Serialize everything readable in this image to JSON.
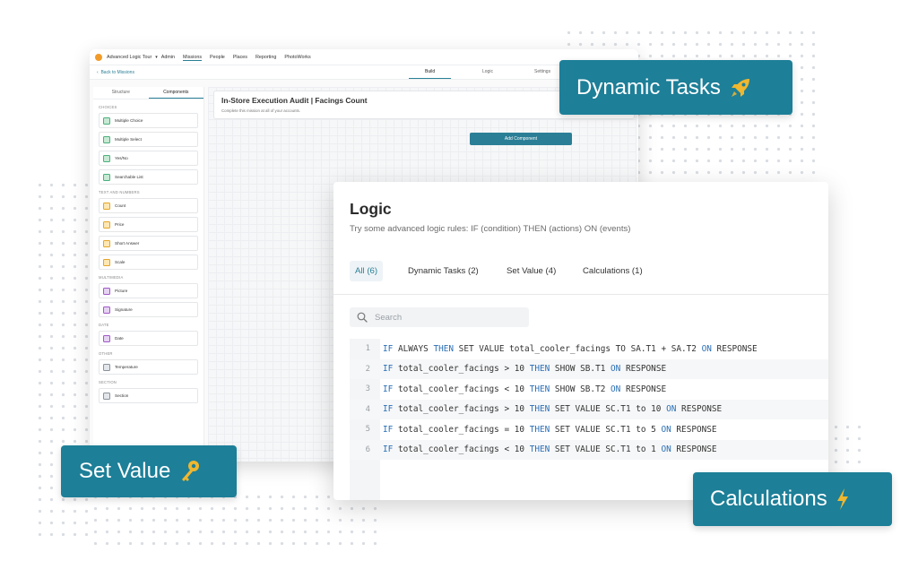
{
  "app": {
    "title": "Advanced Logic Tour",
    "nav": [
      "Admin",
      "Missions",
      "People",
      "Places",
      "Reporting",
      "PhotoWorks"
    ],
    "active_nav": "Missions",
    "back_link": "Back to Missions",
    "subtabs": [
      "Build",
      "Logic",
      "Settings"
    ],
    "active_subtab": "Build",
    "side_tabs": [
      "Structure",
      "Components"
    ],
    "active_side_tab": "Components",
    "sections": [
      {
        "title": "CHOICES",
        "items": [
          {
            "label": "Multiple Choice",
            "icon": "check-icon",
            "color": "green"
          },
          {
            "label": "Multiple Select",
            "icon": "check-icon",
            "color": "green"
          },
          {
            "label": "Yes/No",
            "icon": "check-icon",
            "color": "green"
          },
          {
            "label": "Searchable List",
            "icon": "list-icon",
            "color": "green"
          }
        ]
      },
      {
        "title": "TEXT AND NUMBERS",
        "items": [
          {
            "label": "Count",
            "icon": "hash-icon",
            "color": "yellow"
          },
          {
            "label": "Price",
            "icon": "dollar-icon",
            "color": "yellow"
          },
          {
            "label": "Short Answer",
            "icon": "text-icon",
            "color": "yellow"
          },
          {
            "label": "Scale",
            "icon": "scale-icon",
            "color": "yellow"
          }
        ]
      },
      {
        "title": "MULTIMEDIA",
        "items": [
          {
            "label": "Picture",
            "icon": "camera-icon",
            "color": "purple"
          },
          {
            "label": "Signature",
            "icon": "pen-icon",
            "color": "purple"
          }
        ]
      },
      {
        "title": "DATE",
        "items": [
          {
            "label": "Date",
            "icon": "calendar-icon",
            "color": "purple"
          }
        ]
      },
      {
        "title": "OTHER",
        "items": [
          {
            "label": "Temperature",
            "icon": "thermometer-icon",
            "color": "gray"
          }
        ]
      },
      {
        "title": "SECTION",
        "items": [
          {
            "label": "Section",
            "icon": "section-icon",
            "color": "gray"
          }
        ]
      }
    ],
    "mission_title": "In-Store Execution Audit | Facings Count",
    "mission_subtitle": "Complete this mission at all of your accounts.",
    "add_component": "Add Component"
  },
  "logic": {
    "title": "Logic",
    "subtitle": "Try some advanced logic rules: IF (condition) THEN (actions) ON (events)",
    "tabs": [
      "All (6)",
      "Dynamic Tasks (2)",
      "Set Value (4)",
      "Calculations (1)"
    ],
    "active_tab": "All (6)",
    "search_placeholder": "Search",
    "lines": [
      {
        "n": "1",
        "parts": [
          [
            "kw",
            "IF"
          ],
          [
            "t",
            " ALWAYS "
          ],
          [
            "kw",
            "THEN"
          ],
          [
            "t",
            " SET VALUE total_cooler_facings TO SA.T1 + SA.T2 "
          ],
          [
            "kw",
            "ON"
          ],
          [
            "t",
            " RESPONSE"
          ]
        ]
      },
      {
        "n": "2",
        "parts": [
          [
            "kw",
            "IF"
          ],
          [
            "t",
            " total_cooler_facings > 10 "
          ],
          [
            "kw",
            "THEN"
          ],
          [
            "t",
            " SHOW SB.T1 "
          ],
          [
            "kw",
            "ON"
          ],
          [
            "t",
            " RESPONSE"
          ]
        ]
      },
      {
        "n": "3",
        "parts": [
          [
            "kw",
            "IF"
          ],
          [
            "t",
            " total_cooler_facings < 10 "
          ],
          [
            "kw",
            "THEN"
          ],
          [
            "t",
            " SHOW SB.T2 "
          ],
          [
            "kw",
            "ON"
          ],
          [
            "t",
            " RESPONSE"
          ]
        ]
      },
      {
        "n": "4",
        "parts": [
          [
            "kw",
            "IF"
          ],
          [
            "t",
            " total_cooler_facings > 10 "
          ],
          [
            "kw",
            "THEN"
          ],
          [
            "t",
            " SET VALUE SC.T1 to 10 "
          ],
          [
            "kw",
            "ON"
          ],
          [
            "t",
            " RESPONSE"
          ]
        ]
      },
      {
        "n": "5",
        "parts": [
          [
            "kw",
            "IF"
          ],
          [
            "t",
            " total_cooler_facings = 10 "
          ],
          [
            "kw",
            "THEN"
          ],
          [
            "t",
            " SET VALUE SC.T1 to 5 "
          ],
          [
            "kw",
            "ON"
          ],
          [
            "t",
            " RESPONSE"
          ]
        ]
      },
      {
        "n": "6",
        "parts": [
          [
            "kw",
            "IF"
          ],
          [
            "t",
            " total_cooler_facings < 10 "
          ],
          [
            "kw",
            "THEN"
          ],
          [
            "t",
            " SET VALUE SC.T1 to 1 "
          ],
          [
            "kw",
            "ON"
          ],
          [
            "t",
            " RESPONSE"
          ]
        ]
      }
    ]
  },
  "badges": {
    "dynamic_tasks": {
      "label": "Dynamic Tasks",
      "icon": "rocket-icon"
    },
    "set_value": {
      "label": "Set Value",
      "icon": "key-icon"
    },
    "calculations": {
      "label": "Calculations",
      "icon": "lightning-icon"
    }
  },
  "colors": {
    "accent": "#1d7f98",
    "keyword": "#2b6fb6",
    "icon_gold": "#f0b72f"
  }
}
